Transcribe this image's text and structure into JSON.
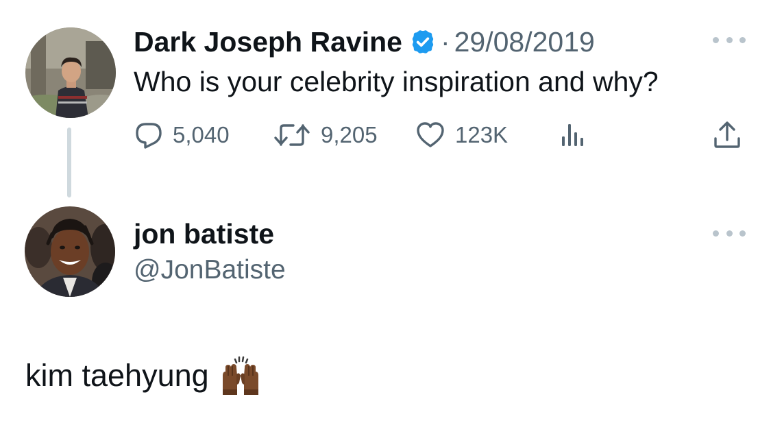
{
  "tweet": {
    "author": {
      "display_name": "Dark Joseph Ravine",
      "verified": true
    },
    "separator": "·",
    "date": "29/08/2019",
    "text": "Who is your celebrity inspiration and why?",
    "stats": {
      "replies": "5,040",
      "reposts": "9,205",
      "likes": "123K"
    }
  },
  "reply": {
    "author": {
      "display_name": "jon batiste",
      "handle": "@JonBatiste"
    },
    "text": "kim taehyung",
    "emoji": "raising-hands-medium-dark-skin"
  },
  "icons": {
    "reply": "comment-bubble-icon",
    "repost": "repost-arrows-icon",
    "like": "heart-icon",
    "views": "bar-chart-icon",
    "share": "share-upload-icon",
    "more": "more-dots-icon",
    "verified": "verified-badge-icon"
  },
  "colors": {
    "verified_blue": "#1d9bf0",
    "secondary_text": "#536471",
    "primary_text": "#0f1419",
    "thread_line": "#cfd9de"
  }
}
